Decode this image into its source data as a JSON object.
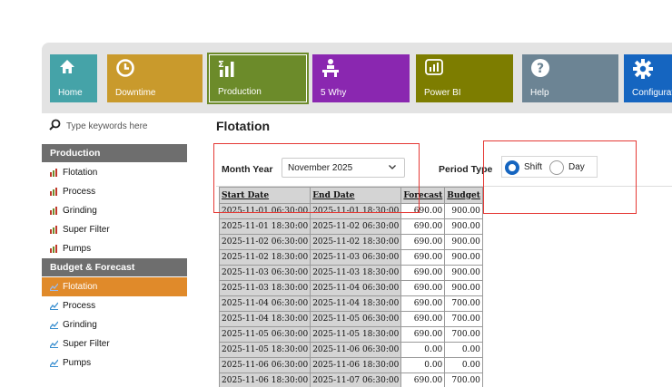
{
  "tiles": [
    {
      "label": "Home",
      "icon": "home-icon",
      "color": "#45a3a8"
    },
    {
      "label": "Downtime",
      "icon": "clock-icon",
      "color": "#c99a2c"
    },
    {
      "label": "Production",
      "icon": "production-icon",
      "color": "#6c8b2a"
    },
    {
      "label": "5 Why",
      "icon": "presenter-icon",
      "color": "#8a27b0"
    },
    {
      "label": "Power BI",
      "icon": "bar-chart-icon",
      "color": "#7d7d00"
    },
    {
      "label": "Help",
      "icon": "question-icon",
      "color": "#6c8494"
    },
    {
      "label": "Configurati",
      "icon": "gear-icon",
      "color": "#1565c0"
    }
  ],
  "search": {
    "placeholder": "Type keywords here"
  },
  "sidebar": {
    "production": {
      "title": "Production",
      "items": [
        "Flotation",
        "Process",
        "Grinding",
        "Super Filter",
        "Pumps"
      ]
    },
    "budget": {
      "title": "Budget & Forecast",
      "items": [
        "Flotation",
        "Process",
        "Grinding",
        "Super Filter",
        "Pumps"
      ],
      "active": "Flotation"
    }
  },
  "page": {
    "title": "Flotation"
  },
  "filters": {
    "month_year_label": "Month Year",
    "month_year_value": "November 2025",
    "period_type_label": "Period Type",
    "options": [
      {
        "label": "Shift",
        "selected": true
      },
      {
        "label": "Day",
        "selected": false
      }
    ]
  },
  "table": {
    "headers": [
      "Start Date",
      "End Date",
      "Forecast",
      "Budget"
    ],
    "rows": [
      [
        "2025-11-01 06:30:00",
        "2025-11-01 18:30:00",
        "690.00",
        "900.00"
      ],
      [
        "2025-11-01 18:30:00",
        "2025-11-02 06:30:00",
        "690.00",
        "900.00"
      ],
      [
        "2025-11-02 06:30:00",
        "2025-11-02 18:30:00",
        "690.00",
        "900.00"
      ],
      [
        "2025-11-02 18:30:00",
        "2025-11-03 06:30:00",
        "690.00",
        "900.00"
      ],
      [
        "2025-11-03 06:30:00",
        "2025-11-03 18:30:00",
        "690.00",
        "900.00"
      ],
      [
        "2025-11-03 18:30:00",
        "2025-11-04 06:30:00",
        "690.00",
        "900.00"
      ],
      [
        "2025-11-04 06:30:00",
        "2025-11-04 18:30:00",
        "690.00",
        "700.00"
      ],
      [
        "2025-11-04 18:30:00",
        "2025-11-05 06:30:00",
        "690.00",
        "700.00"
      ],
      [
        "2025-11-05 06:30:00",
        "2025-11-05 18:30:00",
        "690.00",
        "700.00"
      ],
      [
        "2025-11-05 18:30:00",
        "2025-11-06 06:30:00",
        "0.00",
        "0.00"
      ],
      [
        "2025-11-06 06:30:00",
        "2025-11-06 18:30:00",
        "0.00",
        "0.00"
      ],
      [
        "2025-11-06 18:30:00",
        "2025-11-07 06:30:00",
        "690.00",
        "700.00"
      ]
    ]
  }
}
